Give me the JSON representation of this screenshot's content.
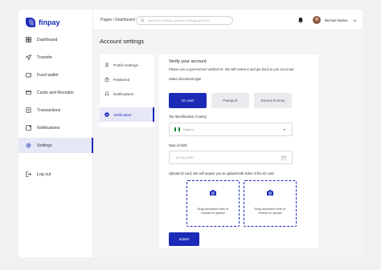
{
  "brand": {
    "name": "finpay",
    "color": "#1b2bb8"
  },
  "sidebar": {
    "items": [
      {
        "label": "Dashboard",
        "icon": "grid-icon"
      },
      {
        "label": "Transfer",
        "icon": "send-icon"
      },
      {
        "label": "Fund wallet",
        "icon": "wallet-icon"
      },
      {
        "label": "Cards and Receipts",
        "icon": "card-icon"
      },
      {
        "label": "Transactions",
        "icon": "transactions-icon"
      },
      {
        "label": "Notifications",
        "icon": "notification-icon"
      },
      {
        "label": "Settings",
        "icon": "gear-icon",
        "active": true
      },
      {
        "label": "Log out",
        "icon": "logout-icon"
      }
    ]
  },
  "header": {
    "breadcrumb": "Pages / Dashboard",
    "search_placeholder": "Search for features, services, settings and more",
    "user_name": "Michael Nelson"
  },
  "page": {
    "title": "Account settings"
  },
  "settings_nav": {
    "items": [
      {
        "label": "Profile Settings",
        "icon": "user-icon"
      },
      {
        "label": "Password",
        "icon": "lock-icon"
      },
      {
        "label": "Notifications",
        "icon": "bell-icon"
      },
      {
        "label": "Verification",
        "icon": "check-circle-icon",
        "active": true
      }
    ]
  },
  "verify": {
    "title": "Verify your account",
    "subtitle": "Please use a government verified ID. We will review it and get back to you via email",
    "doc_type_label": "Select document type",
    "doc_types": [
      "ID card",
      "Passport",
      "Drivers license"
    ],
    "selected_doc_type": "ID card",
    "country_label": "Tax Identification Country",
    "country_value": "Nigeria",
    "dob_label": "Date of birth",
    "dob_value": "26 Jan 1997",
    "upload_label": "Upload ID card, We will require you to upload both sides of the ID card",
    "upload_hint": "Drag document here or browse to upload",
    "submit_label": "Submit"
  }
}
